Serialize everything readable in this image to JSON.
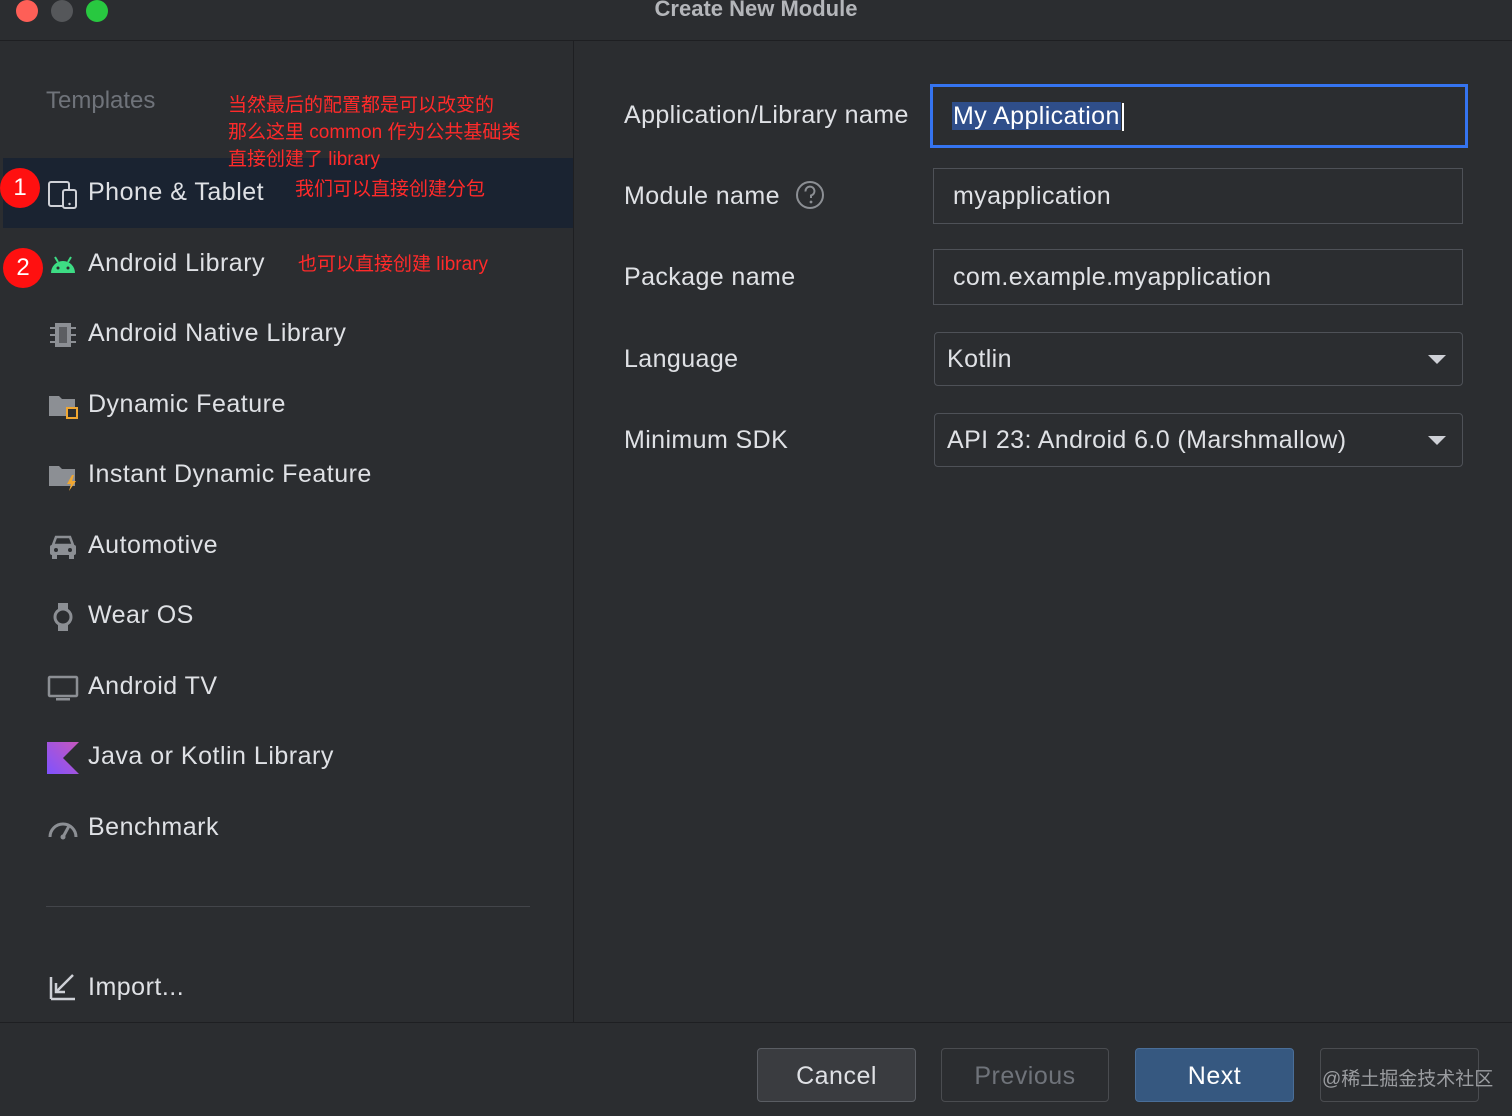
{
  "window": {
    "title": "Create New Module"
  },
  "sidebar": {
    "heading": "Templates",
    "items": [
      {
        "label": "Phone & Tablet",
        "icon": "phone-tablet-icon",
        "selected": true
      },
      {
        "label": "Android Library",
        "icon": "android-icon"
      },
      {
        "label": "Android Native Library",
        "icon": "native-library-icon"
      },
      {
        "label": "Dynamic Feature",
        "icon": "dynamic-feature-folder-icon"
      },
      {
        "label": "Instant Dynamic Feature",
        "icon": "instant-feature-folder-icon"
      },
      {
        "label": "Automotive",
        "icon": "car-icon"
      },
      {
        "label": "Wear OS",
        "icon": "watch-icon"
      },
      {
        "label": "Android TV",
        "icon": "tv-icon"
      },
      {
        "label": "Java or Kotlin Library",
        "icon": "kotlin-icon"
      },
      {
        "label": "Benchmark",
        "icon": "gauge-icon"
      }
    ],
    "import_label": "Import..."
  },
  "annotations": {
    "note_top": [
      "当然最后的配置都是可以改变的",
      "那么这里 common 作为公共基础类",
      "直接创建了 library"
    ],
    "note_phone": "我们可以直接创建分包",
    "note_library": "也可以直接创建 library",
    "badge_1": "1",
    "badge_2": "2"
  },
  "form": {
    "app_name_label": "Application/Library name",
    "app_name_value": "My Application",
    "module_name_label": "Module name",
    "module_name_value": "myapplication",
    "package_name_label": "Package name",
    "package_name_value": "com.example.myapplication",
    "language_label": "Language",
    "language_value": "Kotlin",
    "min_sdk_label": "Minimum SDK",
    "min_sdk_value": "API 23: Android 6.0 (Marshmallow)"
  },
  "footer": {
    "cancel_label": "Cancel",
    "previous_label": "Previous",
    "next_label": "Next",
    "watermark": "@稀土掘金技术社区"
  },
  "colors": {
    "background": "#2b2d30",
    "selected_row": "#1a2331",
    "focus_border": "#3574f0",
    "primary_button": "#365880",
    "annotation_red": "#ff2a2a",
    "android_green": "#3ddc84",
    "kotlin_purple": "#8f6cf0"
  }
}
